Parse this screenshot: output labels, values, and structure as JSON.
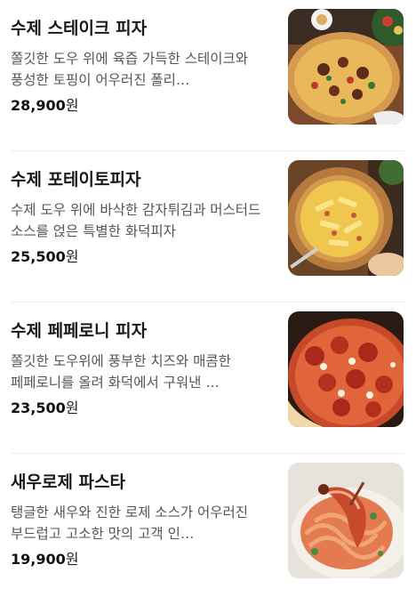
{
  "menu": {
    "items": [
      {
        "name": "수제 스테이크 피자",
        "description": "쫄깃한 도우 위에 육즙 가득한 스테이크와 풍성한 토핑이 어우러진 폴리…",
        "price": "28,900",
        "currency": "원",
        "image_icon": "steak-pizza-image"
      },
      {
        "name": "수제 포테이토피자",
        "description": "수제 도우 위에 바삭한 감자튀김과 머스터드 소스를 얹은 특별한 화덕피자",
        "price": "25,500",
        "currency": "원",
        "image_icon": "potato-pizza-image"
      },
      {
        "name": "수제 페페로니 피자",
        "description": "쫄깃한 도우위에 풍부한 치즈와 매콤한 페페로니를 올려 화덕에서 구워낸 …",
        "price": "23,500",
        "currency": "원",
        "image_icon": "pepperoni-pizza-image"
      },
      {
        "name": "새우로제 파스타",
        "description": "탱글한 새우와 진한 로제 소스가 어우러진 부드럽고 고소한 맛의 고객 인…",
        "price": "19,900",
        "currency": "원",
        "image_icon": "shrimp-rose-pasta-image"
      }
    ]
  }
}
